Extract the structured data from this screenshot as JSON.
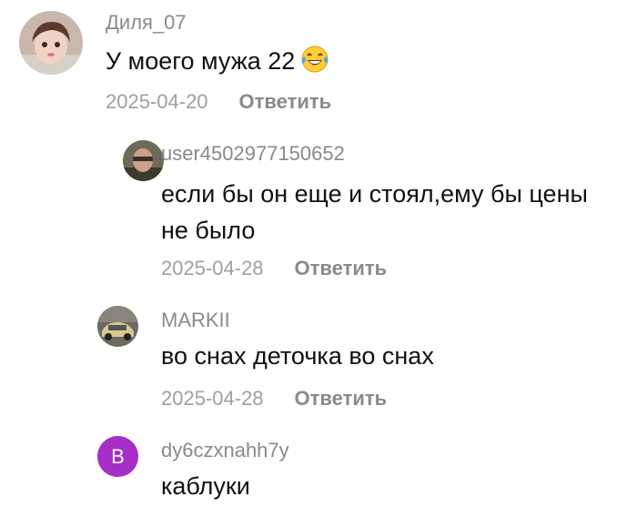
{
  "comments": [
    {
      "username": "Диля_07",
      "text": "У моего мужа 22",
      "emoji": "laughing-tears",
      "date": "2025-04-20",
      "reply_label": "Ответить"
    },
    {
      "username": "user4502977150652",
      "text_line1": "если бы он еще и стоял,ему бы цены",
      "text_line2": "не было",
      "date": "2025-04-28",
      "reply_label": "Ответить"
    },
    {
      "username": "MARKII",
      "text": "во снах деточка во снах",
      "date": "2025-04-28",
      "reply_label": "Ответить"
    },
    {
      "username": "dy6czxnahh7y",
      "avatar_letter": "B",
      "text": "каблуки"
    }
  ],
  "colors": {
    "username": "#8a8a8a",
    "text": "#111111",
    "date": "#a0a0a0",
    "letter_avatar_bg": "#a52ec7"
  }
}
